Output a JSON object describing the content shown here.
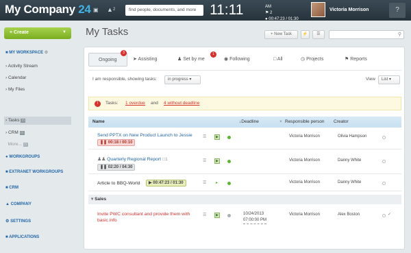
{
  "top": {
    "company": "My Company",
    "company_num": "24",
    "notif_count": "2",
    "search_placeholder": "find people, documents, and more",
    "clock": "11:11",
    "clock_ampm": "AM",
    "clock_tasks": "2",
    "clock_time": "00:47:23 / 01:30",
    "user": "Victoria Morrison",
    "help": "?"
  },
  "sidebar": {
    "create": "Create",
    "my_workspace": "MY WORKSPACE",
    "items": [
      "Activity Stream",
      "Calendar",
      "My Files",
      "Tasks",
      "CRM",
      "More..."
    ],
    "sections": [
      "WORKGROUPS",
      "EXTRANET WORKGROUPS",
      "CRM",
      "COMPANY",
      "SETTINGS",
      "APPLICATIONS"
    ]
  },
  "main": {
    "title": "My Tasks",
    "new_task": "+ New Task",
    "tabs": {
      "ongoing": "Ongoing",
      "ongoing_badge": "3",
      "assisting": "Assisting",
      "set_by_me": "Set by me",
      "set_badge": "1",
      "following": "Following",
      "all": "All",
      "projects": "Projects",
      "reports": "Reports"
    },
    "filter": {
      "prefix": "I am responsible, showing tasks:",
      "status": "in progress",
      "view_label": "View",
      "view": "List"
    },
    "alert": {
      "label": "Tasks:",
      "overdue": "1 overdue",
      "and": "and",
      "no_deadline": "4 without deadline"
    },
    "columns": {
      "name": "Name",
      "deadline": "Deadline",
      "responsible": "Responsible person",
      "creator": "Creator"
    },
    "rows": [
      {
        "name": "Send PPTX on New Product Launch to Jessie",
        "timer": "00:18 / 00:10",
        "deadline": "",
        "responsible": "Victoria Morrison",
        "creator": "Olivia Hampson"
      },
      {
        "name": "Quarterly Regional Report",
        "comments": "1",
        "timer": "02:20 / 04:30",
        "deadline": "",
        "responsible": "Victoria Morrison",
        "creator": "Danny White"
      },
      {
        "name": "Article to BBQ-World",
        "timer": "00:47:23 / 01:30",
        "deadline": "",
        "responsible": "Victoria Morrison",
        "creator": "Danny White"
      }
    ],
    "group": "Sales",
    "sales_row": {
      "name_1": "Invite PWC consultant and provide them with",
      "name_2": "basic info",
      "deadline_date": "10/24/2013",
      "deadline_time": "07:00:00 PM",
      "responsible": "Victoria Morrison",
      "creator": "Alex Boston"
    }
  },
  "colors": {
    "brand": "#3fb3e6",
    "create": "#8bbd2a",
    "alert": "#d9302c",
    "link": "#2166a8"
  }
}
